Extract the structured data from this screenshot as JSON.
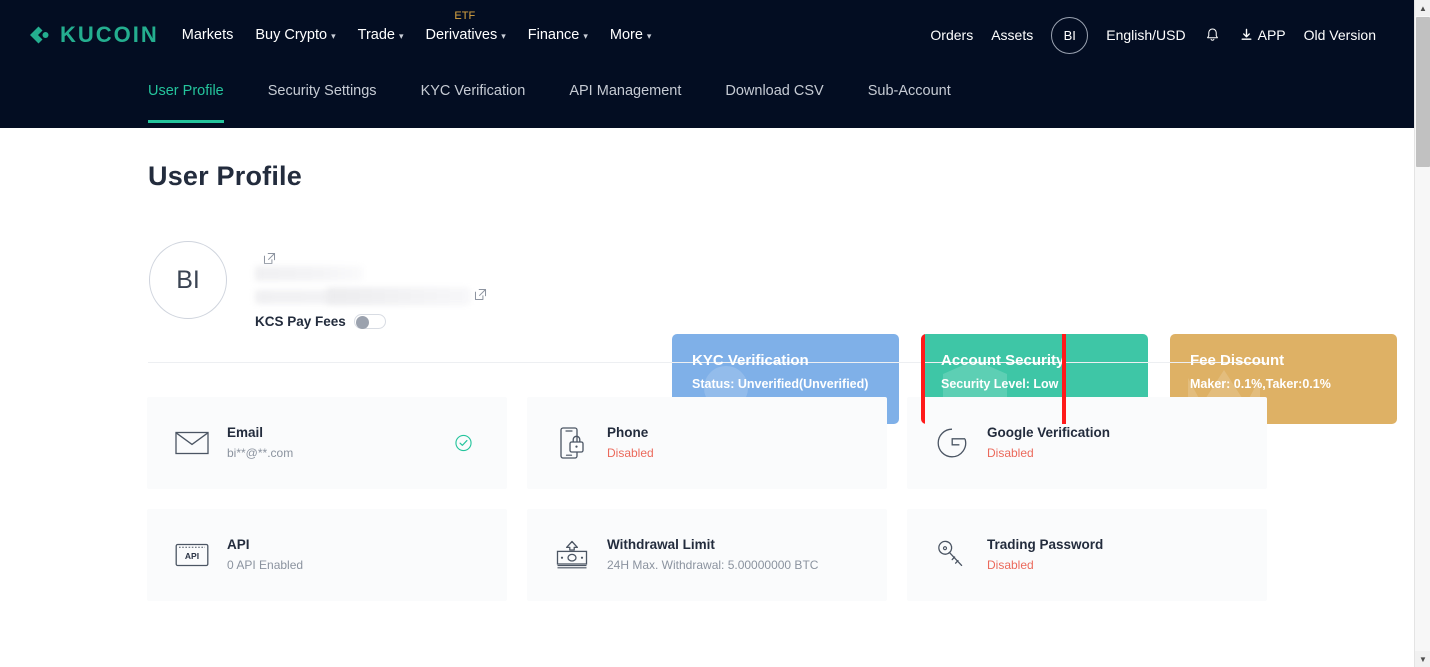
{
  "header": {
    "brand": "KUCOIN",
    "brand_color": "#24ae8f",
    "nav": [
      {
        "label": "Markets",
        "has_caret": false,
        "badge": null
      },
      {
        "label": "Buy Crypto",
        "has_caret": true,
        "badge": null
      },
      {
        "label": "Trade",
        "has_caret": true,
        "badge": null
      },
      {
        "label": "Derivatives",
        "has_caret": true,
        "badge": "ETF"
      },
      {
        "label": "Finance",
        "has_caret": true,
        "badge": null
      },
      {
        "label": "More",
        "has_caret": true,
        "badge": null
      }
    ],
    "right": {
      "orders": "Orders",
      "assets": "Assets",
      "avatar_initials": "BI",
      "locale": "English/USD",
      "bell_icon": "bell-icon",
      "app_icon": "download-icon",
      "app": "APP",
      "old_version": "Old Version"
    }
  },
  "subnav": {
    "active_index": 0,
    "tabs": [
      {
        "label": "User Profile"
      },
      {
        "label": "Security Settings"
      },
      {
        "label": "KYC Verification"
      },
      {
        "label": "API Management"
      },
      {
        "label": "Download CSV"
      },
      {
        "label": "Sub-Account"
      }
    ],
    "active_color": "#24c49c"
  },
  "main": {
    "page_title": "User Profile",
    "profile": {
      "avatar_initials": "BI",
      "name_redacted": true,
      "id_redacted": true,
      "edit_name_icon": "edit-pencil-icon",
      "edit_id_icon": "edit-pencil-icon",
      "kcs_pay_fees_label": "KCS Pay Fees",
      "kcs_pay_fees_on": false
    },
    "status_cards": [
      {
        "id": "kyc",
        "title": "KYC Verification",
        "subtitle": "Status: Unverified(Unverified)",
        "bg": "#7fb0e8",
        "watermark": "badge-icon",
        "highlighted": false
      },
      {
        "id": "account-security",
        "title": "Account Security",
        "subtitle": "Security Level: Low",
        "bg": "#3ec6a6",
        "watermark": "shield-icon",
        "highlighted": true,
        "highlight_color": "#ff1a1a"
      },
      {
        "id": "fee-discount",
        "title": "Fee Discount",
        "subtitle": "Maker: 0.1%,Taker:0.1%",
        "bg": "#deb165",
        "watermark": "crown-icon",
        "highlighted": false
      }
    ],
    "security_items": [
      {
        "name": "Email",
        "status": "bi**@**.com",
        "status_type": "normal",
        "icon": "envelope-icon",
        "verified": true
      },
      {
        "name": "Phone",
        "status": "Disabled",
        "status_type": "disabled",
        "icon": "phone-lock-icon",
        "verified": false
      },
      {
        "name": "Google Verification",
        "status": "Disabled",
        "status_type": "disabled",
        "icon": "google-icon",
        "verified": false
      },
      {
        "name": "API",
        "status": "0 API Enabled",
        "status_type": "normal",
        "icon": "api-icon",
        "verified": false
      },
      {
        "name": "Withdrawal Limit",
        "status": "24H Max. Withdrawal: 5.00000000 BTC",
        "status_type": "normal",
        "icon": "banknote-icon",
        "verified": false
      },
      {
        "name": "Trading Password",
        "status": "Disabled",
        "status_type": "disabled",
        "icon": "key-icon",
        "verified": false
      }
    ]
  },
  "scrollbar": {
    "up_arrow": "▲",
    "down_arrow": "▼"
  }
}
